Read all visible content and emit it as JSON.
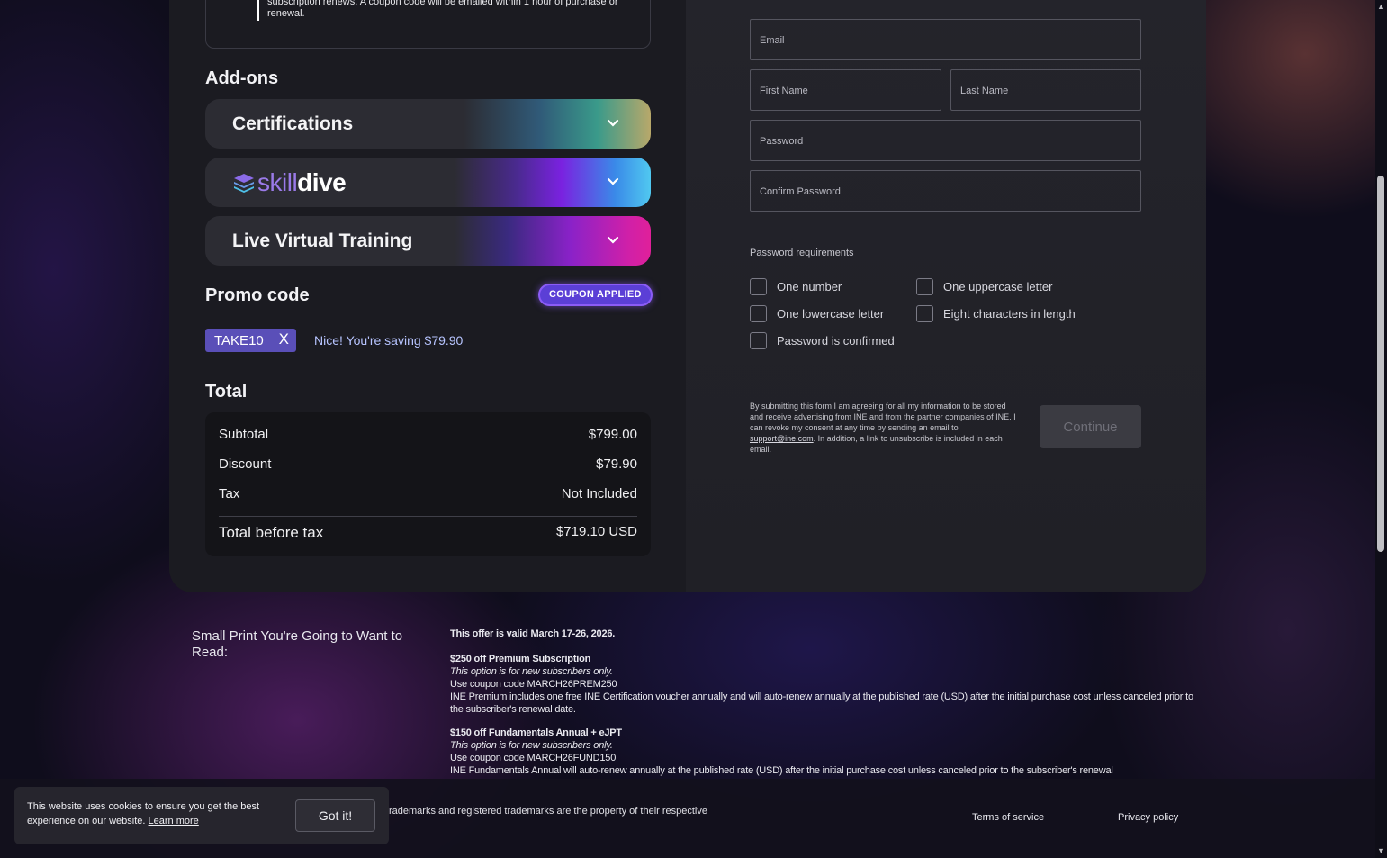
{
  "plan_note": "subscription renews. A coupon code will be emailed within 1 hour of purchase or renewal.",
  "addons": {
    "title": "Add-ons",
    "items": [
      {
        "label": "Certifications"
      },
      {
        "label_a": "skill",
        "label_b": "dive"
      },
      {
        "label": "Live Virtual Training"
      }
    ]
  },
  "promo": {
    "title": "Promo code",
    "badge": "COUPON APPLIED",
    "code": "TAKE10",
    "remove": "X",
    "message": "Nice! You're saving $79.90"
  },
  "total": {
    "title": "Total",
    "rows": [
      {
        "label": "Subtotal",
        "value": "$799.00"
      },
      {
        "label": "Discount",
        "value": "$79.90"
      },
      {
        "label": "Tax",
        "value": "Not Included"
      }
    ],
    "final": {
      "label": "Total before tax",
      "value": "$719.10 USD"
    }
  },
  "form": {
    "email": "Email",
    "first_name": "First Name",
    "last_name": "Last Name",
    "password": "Password",
    "confirm_password": "Confirm Password",
    "requirements_title": "Password requirements",
    "requirements": [
      "One number",
      "One uppercase letter",
      "One lowercase letter",
      "Eight characters in length",
      "Password is confirmed"
    ],
    "consent_a": "By submitting this form I am agreeing for all my information to be stored and receive advertising from INE and from the partner companies of INE. I can revoke my consent at any time by sending an email to ",
    "consent_link": "support@ine.com",
    "consent_b": ". In addition, a link to unsubscribe is included in each email.",
    "continue": "Continue"
  },
  "small_print": {
    "title": "Small Print You're Going to Want to Read:",
    "valid": "This offer is valid March 17-26, 2026.",
    "offer1_title": "$250 off Premium Subscription",
    "offer1_note": "This option is for new subscribers only.",
    "offer1_code": "Use coupon code MARCH26PREM250",
    "offer1_desc": "INE Premium includes one free INE Certification voucher annually and will auto-renew annually at the published rate (USD) after the initial purchase cost unless canceled prior to the subscriber's renewal date.",
    "offer2_title": "$150 off Fundamentals Annual + eJPT",
    "offer2_note": "This option is for new subscribers only.",
    "offer2_code": "Use coupon code MARCH26FUND150",
    "offer2_desc": "INE Fundamentals Annual will auto-renew annually at the published rate (USD) after the initial purchase cost unless canceled prior to the subscriber's renewal"
  },
  "footer": {
    "trademark": "rademarks and registered trademarks are the property of their respective",
    "terms": "Terms of service",
    "privacy": "Privacy policy"
  },
  "cookie": {
    "text": "This website uses cookies to ensure you get the best experience on our website.",
    "learn_more": "Learn more",
    "button": "Got it!"
  }
}
